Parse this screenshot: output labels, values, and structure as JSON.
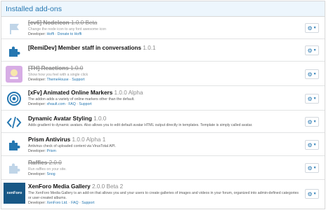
{
  "panel": {
    "title": "Installed add-ons"
  },
  "addons": [
    {
      "title": "[cv6] NodeIcon",
      "version": "1.0.0 Beta",
      "description": "Change the node icon to any font awesome icon",
      "developer_prefix": "Developer:",
      "developer": "Hoffi",
      "links": [
        "Donate to Hoffi"
      ],
      "icon": "flag-icon",
      "disabled": true
    },
    {
      "title": "[RemiDev] Member staff in conversations",
      "version": "1.0.1",
      "description": "",
      "developer_prefix": "",
      "developer": "",
      "links": [],
      "icon": "puzzle-icon",
      "disabled": false
    },
    {
      "title": "[TH] Reactions",
      "version": "1.0.0",
      "description": "Show how you feel with a single click",
      "developer_prefix": "Developer:",
      "developer": "ThemeHouse",
      "links": [
        "Support"
      ],
      "icon": "th-logo-icon",
      "disabled": true
    },
    {
      "title": "[xFv] Animated Online Markers",
      "version": "1.0.0 Alpha",
      "description": "The addon adds a variety of online markers other than the default.",
      "developer_prefix": "Developer:",
      "developer": "xfvault.com",
      "links": [
        "FAQ",
        "Support"
      ],
      "icon": "target-icon",
      "disabled": false
    },
    {
      "title": "Dynamic Avatar Styling",
      "version": "1.0.0",
      "description": "Adds gradient to dynamic avatars. Also allows you to edit default avatar HTML output directly in templates. Template is simply called avatar.",
      "developer_prefix": "",
      "developer": "",
      "links": [],
      "icon": "code-icon",
      "disabled": false
    },
    {
      "title": "Prism Antivirus",
      "version": "1.0.0 Alpha 1",
      "description": "Antivirus check of uploaded content via VirusTotal API.",
      "developer_prefix": "Developer:",
      "developer": "Prism",
      "links": [],
      "icon": "puzzle-icon",
      "disabled": false
    },
    {
      "title": "Raffles",
      "version": "2.0.0",
      "description": "Run raffles on your site.",
      "developer_prefix": "Developer:",
      "developer": "Snog",
      "links": [],
      "icon": "puzzle-icon",
      "disabled": true
    },
    {
      "title": "XenForo Media Gallery",
      "version": "2.0.0 Beta 2",
      "description": "The XenForo Media Gallery is an add-on that allows you and your users to create galleries of images and videos in your forum, organized into admin-defined categories or user-created albums.",
      "developer_prefix": "Developer:",
      "developer": "XenForo Ltd.",
      "links": [
        "FAQ",
        "Support"
      ],
      "icon": "xenforo-logo-icon",
      "logo_text": "xenForo",
      "disabled": false
    }
  ],
  "controls": {
    "cog_glyph": "⚙",
    "caret_glyph": "▼"
  },
  "colors": {
    "accent": "#2577b1",
    "header_bg": "#edf6fd",
    "border": "#d8d8d8"
  }
}
